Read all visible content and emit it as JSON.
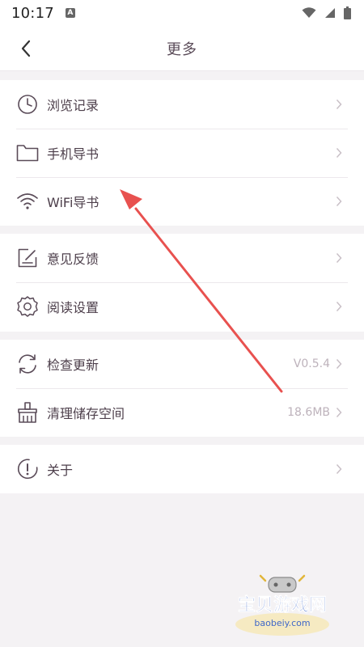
{
  "status_bar": {
    "time": "10:17",
    "notification_icon": "a-icon",
    "icons": [
      "wifi-icon",
      "cellular-icon",
      "battery-icon"
    ]
  },
  "header": {
    "title": "更多",
    "back_icon": "chevron-left-icon"
  },
  "groups": [
    {
      "items": [
        {
          "label": "浏览记录",
          "icon": "clock-icon"
        },
        {
          "label": "手机导书",
          "icon": "folder-icon"
        },
        {
          "label": "WiFi导书",
          "icon": "wifi-icon"
        }
      ]
    },
    {
      "items": [
        {
          "label": "意见反馈",
          "icon": "feedback-icon"
        },
        {
          "label": "阅读设置",
          "icon": "gear-icon"
        }
      ]
    },
    {
      "items": [
        {
          "label": "检查更新",
          "icon": "refresh-icon",
          "value": "V0.5.4"
        },
        {
          "label": "清理储存空间",
          "icon": "broom-icon",
          "value": "18.6MB"
        }
      ]
    },
    {
      "items": [
        {
          "label": "关于",
          "icon": "info-icon"
        }
      ]
    }
  ],
  "watermark": {
    "brand": "宝贝游戏网",
    "url": "baobeiy.com"
  },
  "colors": {
    "text_primary": "#4d3f4b",
    "text_secondary": "#bdb2bb",
    "background": "#f4f2f4",
    "annotation_red": "#e8514f"
  }
}
